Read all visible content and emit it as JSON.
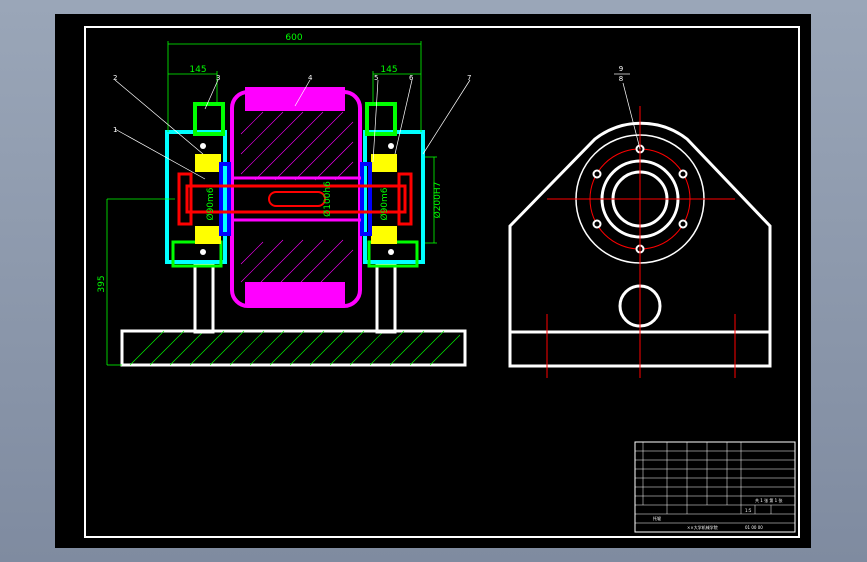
{
  "drawing": {
    "dimensions": {
      "overall_width": "600",
      "left_offset": "145",
      "right_offset": "145",
      "height": "395"
    },
    "balloons": [
      "1",
      "2",
      "3",
      "4",
      "5",
      "6",
      "7"
    ],
    "bore_labels": {
      "left_bearing": "Ø90m6",
      "shaft": "Ø100h6",
      "right_bearing": "Ø90m6",
      "housing": "Ø200H7"
    },
    "side_view_callout": {
      "top": "9",
      "bottom": "8"
    }
  },
  "title_block": {
    "part_label": "托辊",
    "scale": "1:5",
    "drawing_number": "01 00 00",
    "company_line": "××大学机械学院",
    "sheet_info": "共 1 张 第 1 张"
  },
  "colors": {
    "outline": "#ffffff",
    "dimension": "#00ff00",
    "roller": "#ff00ff",
    "bearing": "#ffff00",
    "housing": "#00ffff",
    "shaft": "#ff0000",
    "seal": "#0000ff",
    "centerline": "#ff0000"
  }
}
